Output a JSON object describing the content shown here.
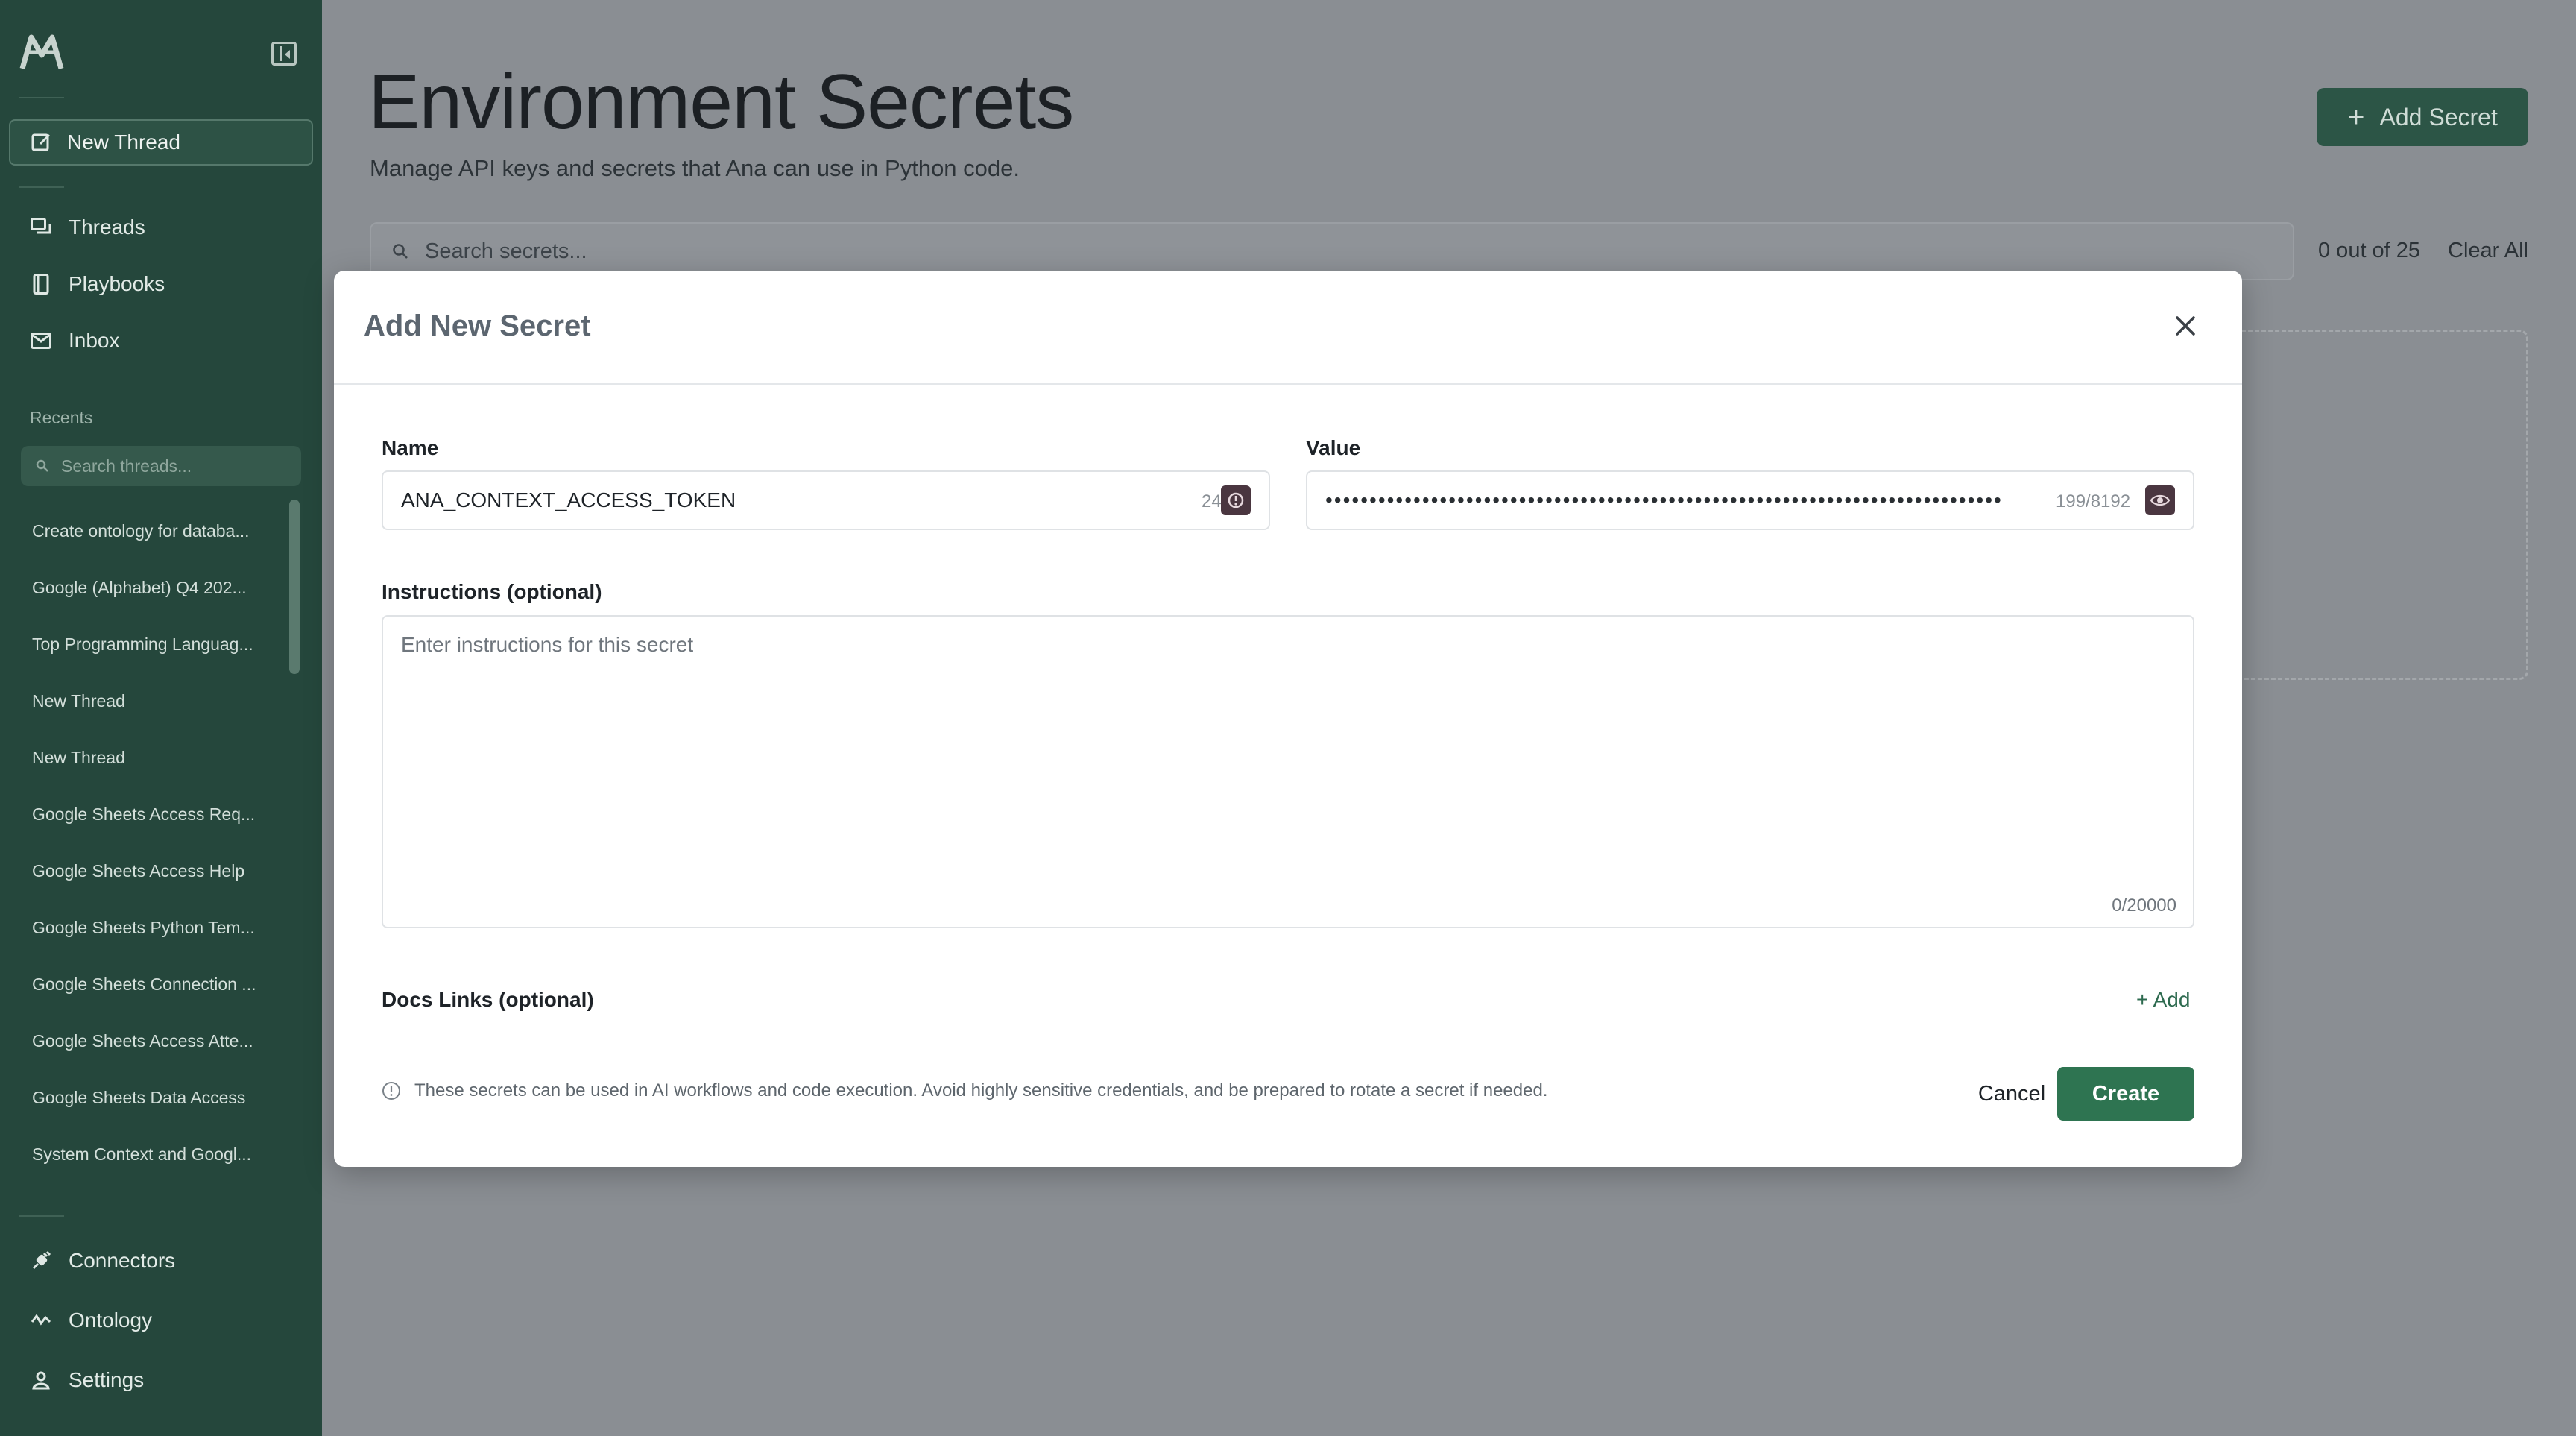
{
  "sidebar": {
    "new_thread_label": "New Thread",
    "nav": [
      {
        "label": "Threads",
        "icon": "threads-icon"
      },
      {
        "label": "Playbooks",
        "icon": "book-icon"
      },
      {
        "label": "Inbox",
        "icon": "inbox-icon"
      }
    ],
    "recents_label": "Recents",
    "search_placeholder": "Search threads...",
    "recents": [
      "Create ontology for databa...",
      "Google (Alphabet) Q4 202...",
      "Top Programming Languag...",
      "New Thread",
      "New Thread",
      "Google Sheets Access Req...",
      "Google Sheets Access Help",
      "Google Sheets Python Tem...",
      "Google Sheets Connection ...",
      "Google Sheets Access Atte...",
      "Google Sheets Data Access",
      "System Context and Googl..."
    ],
    "bottom_nav": [
      {
        "label": "Connectors",
        "icon": "plug-icon"
      },
      {
        "label": "Ontology",
        "icon": "ontology-icon"
      },
      {
        "label": "Settings",
        "icon": "user-icon"
      }
    ],
    "colors": {
      "background": "#25473c",
      "accent": "#2e7451"
    }
  },
  "main": {
    "title": "Environment Secrets",
    "subtitle": "Manage API keys and secrets that Ana can use in Python code.",
    "add_secret_label": "Add Secret",
    "search_placeholder": "Search secrets...",
    "count_text": "0 out of 25",
    "clear_all_label": "Clear All"
  },
  "modal": {
    "title": "Add New Secret",
    "name_label": "Name",
    "name_value": "ANA_CONTEXT_ACCESS_TOKEN",
    "name_counter": "24",
    "value_label": "Value",
    "value_masked": "•••••••••••••••••••••••••••••••••••••••••••••••••••••••••••••••••••••••••••••",
    "value_counter": "199/8192",
    "instructions_label": "Instructions (optional)",
    "instructions_placeholder": "Enter instructions for this secret",
    "instructions_counter": "0/20000",
    "docs_label": "Docs Links (optional)",
    "docs_add_label": "+ Add",
    "footer_note": "These secrets can be used in AI workflows and code execution. Avoid highly sensitive credentials, and be prepared to rotate a secret if needed.",
    "cancel_label": "Cancel",
    "create_label": "Create"
  }
}
